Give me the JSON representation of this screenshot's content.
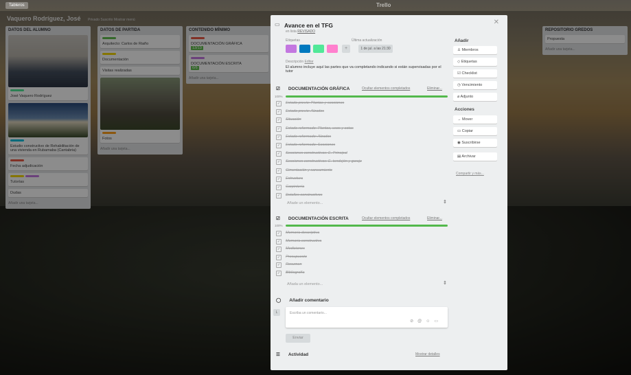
{
  "topbar": {
    "boards_label": "Tableros",
    "logo": "Trello"
  },
  "board": {
    "title": "Vaquero Rodríguez, José",
    "subtitle": "Privado   Suscrito   Mostrar menú"
  },
  "lists": [
    {
      "title": "DATOS DEL ALUMNO",
      "cards": [
        "José Vaquero Rodríguez",
        "Estudio constructivo de Rehabilitación de una vivienda en Rubamaba (Cantabria)",
        "Fecha adjudicación",
        "Tutorías",
        "Dudas"
      ],
      "add": "Añadir una tarjeta..."
    },
    {
      "title": "DATOS DE PARTIDA",
      "cards": [
        "Arquitecto: Carlos de Riaño",
        "Documentación",
        "Visitas realizadas",
        "Fotos"
      ],
      "add": "Añadir una tarjeta..."
    },
    {
      "title": "CONTENIDO MÍNIMO",
      "cards": [
        "DOCUMENTACIÓN GRÁFICA",
        "DOCUMENTACIÓN ESCRITA"
      ],
      "badges": [
        "13/13",
        "6/6"
      ],
      "add": "Añadir una tarjeta..."
    },
    {
      "title": "REPOSITORIO GREDOS",
      "cards": [
        "Propuesta"
      ],
      "add": "Añadir una tarjeta..."
    }
  ],
  "modal": {
    "title": "Avance en el TFG",
    "in_list_prefix": "en lista",
    "in_list": "REVISADO",
    "labels_heading": "Etiquetas",
    "label_colors": [
      "#c377e0",
      "#0079bf",
      "#51e898",
      "#ff80ce"
    ],
    "last_update_heading": "Última actualización",
    "last_update": "1 de jul. a las 21:30",
    "description_heading": "Descripción",
    "edit_link": "Editar",
    "description": "El alumno incluye aquí las partes que va completando indicando si están supervisadas por el tutor",
    "checklists": [
      {
        "title": "DOCUMENTACIÓN GRÁFICA",
        "progress": "100%",
        "hide_label": "Ocultar elementos completados",
        "delete_label": "Eliminar...",
        "items": [
          "Estado previo: Plantas y secciones",
          "Estado previo: Alzados",
          "Situación",
          "Estado reformado: Plantas, usos y cotas",
          "Estado reformado: Alzados",
          "Estado reformado: Secciones",
          "Secciones constructivas: E. Principal",
          "Secciones constructivas: E. tendejón y garaje",
          "Cimentación y saneamiento",
          "Estructura",
          "Carpintería",
          "Detalles constructivos"
        ],
        "add_item": "Añade un elemento..."
      },
      {
        "title": "DOCUMENTACIÓN ESCRITA",
        "progress": "100%",
        "hide_label": "Ocultar elementos completados",
        "delete_label": "Eliminar...",
        "items": [
          "Memoria descriptiva",
          "Memoria constructiva",
          "Mediciones",
          "Presupuesto",
          "Resumen",
          "Bibliografía"
        ],
        "add_item": "Añada un elemento..."
      }
    ],
    "comment_heading": "Añadir comentario",
    "avatar_initial": "L",
    "comment_placeholder": "Escriba un comentario...",
    "send_label": "Enviar",
    "activity_heading": "Actividad",
    "show_details": "Mostrar detalles",
    "sidebar": {
      "add_heading": "Añadir",
      "add_buttons": [
        "Miembros",
        "Etiquetas",
        "Checklist",
        "Vencimiento",
        "Adjunto"
      ],
      "actions_heading": "Acciones",
      "action_buttons": [
        "Mover",
        "Copiar",
        "Suscribirse",
        "Archivar"
      ],
      "share": "Compartir y más..."
    }
  }
}
